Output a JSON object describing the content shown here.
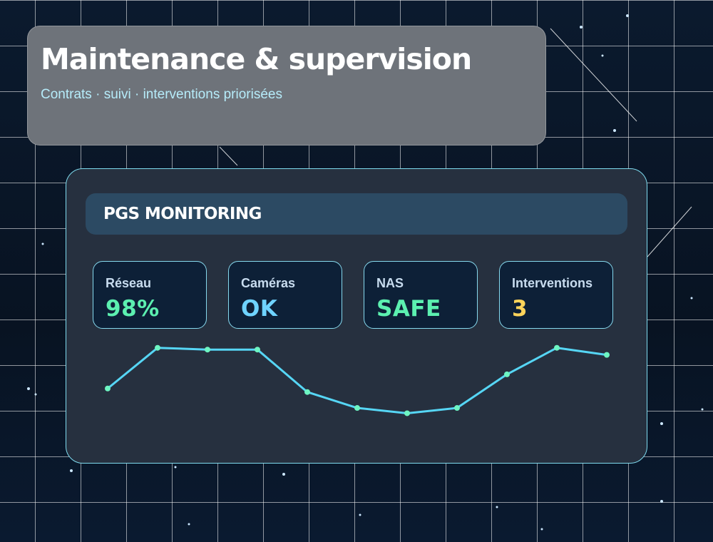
{
  "header": {
    "title": "Maintenance & supervision",
    "subtitle": "Contrats · suivi · interventions priorisées"
  },
  "panel": {
    "title": "PGS MONITORING",
    "metrics": [
      {
        "label": "Réseau",
        "value": "98%",
        "color": "#5cf0b0"
      },
      {
        "label": "Caméras",
        "value": "OK",
        "color": "#6fd3ff"
      },
      {
        "label": "NAS",
        "value": "SAFE",
        "color": "#5cf0b0"
      },
      {
        "label": "Interventions",
        "value": "3",
        "color": "#ffd45a"
      }
    ]
  },
  "chart_data": {
    "type": "line",
    "x": [
      1,
      2,
      3,
      4,
      5,
      6,
      7,
      8,
      9,
      10,
      11
    ],
    "values": [
      38,
      61,
      60,
      60,
      36,
      27,
      24,
      27,
      46,
      61,
      57
    ],
    "ylim": [
      0,
      100
    ],
    "line_color": "#56d6f5",
    "point_color": "#6ef5c2"
  },
  "colors": {
    "accent": "#7fdcf0",
    "panel_bg": "#26303f",
    "title_card_bg": "#6e737a"
  }
}
